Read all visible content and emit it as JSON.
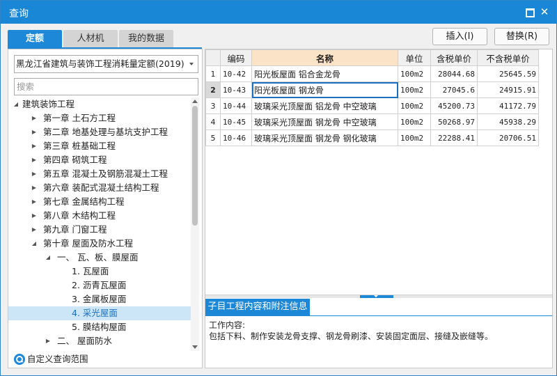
{
  "window": {
    "title": "查询",
    "maximize_icon": "maximize-icon",
    "close_icon": "close-icon",
    "close_glyph": "✕"
  },
  "tabs": [
    {
      "label": "定额",
      "active": true
    },
    {
      "label": "人材机",
      "active": false
    },
    {
      "label": "我的数据",
      "active": false
    }
  ],
  "buttons": {
    "insert": "插入(I)",
    "replace": "替换(R)"
  },
  "left": {
    "quota_library": "黑龙江省建筑与装饰工程消耗量定额(2019)",
    "search_placeholder": "搜索",
    "tree": [
      {
        "label": "建筑装饰工程",
        "toggle": "◢",
        "level": 0
      },
      {
        "label": "第一章 土石方工程",
        "toggle": "▶",
        "level": 1
      },
      {
        "label": "第二章 地基处理与基坑支护工程",
        "toggle": "▶",
        "level": 1
      },
      {
        "label": "第三章 桩基础工程",
        "toggle": "▶",
        "level": 1
      },
      {
        "label": "第四章 砌筑工程",
        "toggle": "▶",
        "level": 1
      },
      {
        "label": "第五章 混凝土及钢筋混凝土工程",
        "toggle": "▶",
        "level": 1
      },
      {
        "label": "第六章 装配式混凝土结构工程",
        "toggle": "▶",
        "level": 1
      },
      {
        "label": "第七章 金属结构工程",
        "toggle": "▶",
        "level": 1
      },
      {
        "label": "第八章 木结构工程",
        "toggle": "▶",
        "level": 1
      },
      {
        "label": "第九章 门窗工程",
        "toggle": "▶",
        "level": 1
      },
      {
        "label": "第十章 屋面及防水工程",
        "toggle": "◢",
        "level": 1
      },
      {
        "label": "一、 瓦、板、膜屋面",
        "toggle": "◢",
        "level": 2
      },
      {
        "label": "1. 瓦屋面",
        "toggle": "",
        "level": 3
      },
      {
        "label": "2. 沥青瓦屋面",
        "toggle": "",
        "level": 3
      },
      {
        "label": "3. 金属板屋面",
        "toggle": "",
        "level": 3
      },
      {
        "label": "4. 采光屋面",
        "toggle": "",
        "level": 3,
        "selected": true
      },
      {
        "label": "5. 膜结构屋面",
        "toggle": "",
        "level": 3
      },
      {
        "label": "二、 屋面防水",
        "toggle": "▶",
        "level": 2
      }
    ],
    "custom_scope": "自定义查询范围"
  },
  "table": {
    "headers": [
      "",
      "编码",
      "名称",
      "单位",
      "含税单价",
      "不含税单价"
    ],
    "rows": [
      {
        "idx": "1",
        "code": "10-42",
        "name": "阳光板屋面 铝合金龙骨",
        "unit": "100m2",
        "price_tax": "28044.68",
        "price_notax": "25645.59"
      },
      {
        "idx": "2",
        "code": "10-43",
        "name": "阳光板屋面 钢龙骨",
        "unit": "100m2",
        "price_tax": "27045.6",
        "price_notax": "24915.91"
      },
      {
        "idx": "3",
        "code": "10-44",
        "name": "玻璃采光顶屋面 铝龙骨 中空玻璃",
        "unit": "100m2",
        "price_tax": "45200.73",
        "price_notax": "41172.79"
      },
      {
        "idx": "4",
        "code": "10-45",
        "name": "玻璃采光顶屋面 钢龙骨 中空玻璃",
        "unit": "100m2",
        "price_tax": "50268.97",
        "price_notax": "45938.29"
      },
      {
        "idx": "5",
        "code": "10-46",
        "name": "玻璃采光顶屋面 钢龙骨 钢化玻璃",
        "unit": "100m2",
        "price_tax": "22288.41",
        "price_notax": "20706.51"
      }
    ]
  },
  "info": {
    "tab_label": "子目工程内容和附注信息",
    "line1": "工作内容:",
    "line2": "包括下料、制作安装龙骨支撑、钢龙骨刷漆、安装固定面层、接缝及嵌缝等。"
  }
}
